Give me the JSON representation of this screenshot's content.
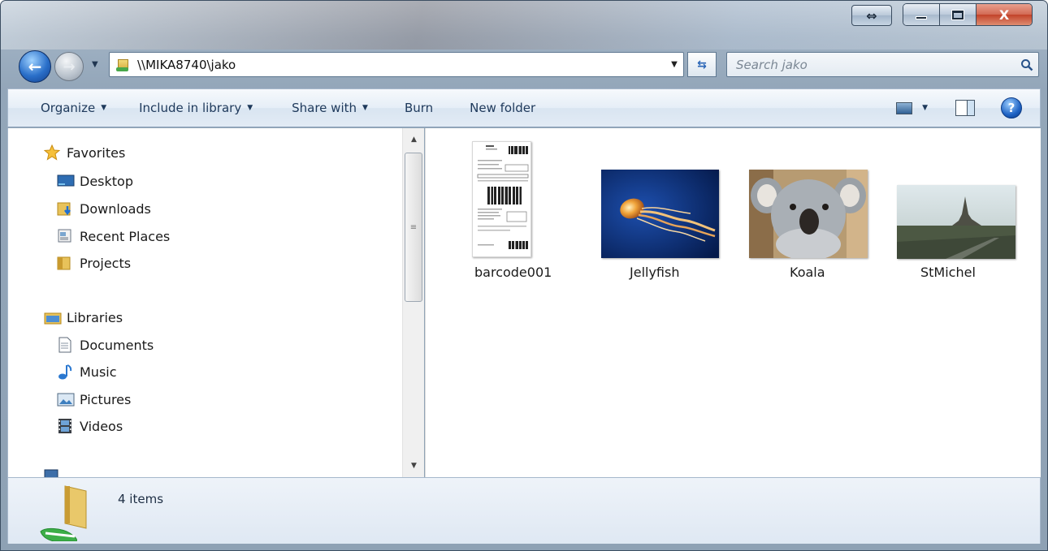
{
  "window": {
    "caption_buttons": {
      "extra": "⇔",
      "minimize": "",
      "maximize": "",
      "close": "X"
    }
  },
  "address_bar": {
    "path": "\\\\MIKA8740\\jako"
  },
  "search": {
    "placeholder": "Search jako"
  },
  "toolbar": {
    "organize": "Organize",
    "include_in_library": "Include in library",
    "share_with": "Share with",
    "burn": "Burn",
    "new_folder": "New folder"
  },
  "nav_pane": {
    "favorites": {
      "label": "Favorites",
      "items": [
        {
          "label": "Desktop",
          "icon": "desktop-icon"
        },
        {
          "label": "Downloads",
          "icon": "downloads-folder-icon"
        },
        {
          "label": "Recent Places",
          "icon": "recent-places-icon"
        },
        {
          "label": "Projects",
          "icon": "folder-icon"
        }
      ]
    },
    "libraries": {
      "label": "Libraries",
      "items": [
        {
          "label": "Documents",
          "icon": "documents-icon"
        },
        {
          "label": "Music",
          "icon": "music-icon"
        },
        {
          "label": "Pictures",
          "icon": "pictures-icon"
        },
        {
          "label": "Videos",
          "icon": "videos-icon"
        }
      ]
    }
  },
  "files": [
    {
      "name": "barcode001",
      "kind": "barcode-document-thumbnail"
    },
    {
      "name": "Jellyfish",
      "kind": "jellyfish-photo-thumbnail"
    },
    {
      "name": "Koala",
      "kind": "koala-photo-thumbnail"
    },
    {
      "name": "StMichel",
      "kind": "landscape-photo-thumbnail"
    }
  ],
  "status_bar": {
    "item_count": "4 items"
  },
  "colors": {
    "accent": "#1e395b",
    "frame": "#9fb1c3",
    "close": "#c2432a"
  }
}
